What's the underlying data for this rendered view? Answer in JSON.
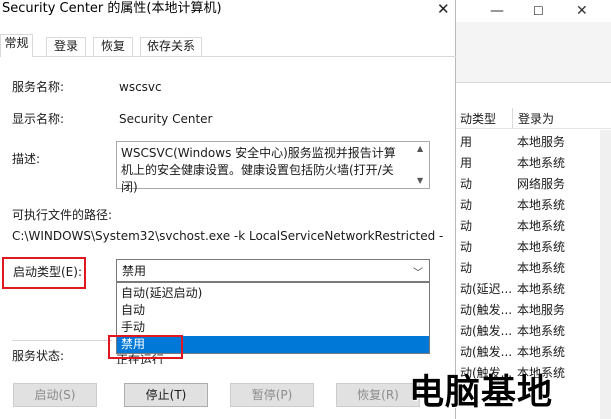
{
  "window": {
    "title": "Security Center 的属性(本地计算机)",
    "close_glyph": "✕"
  },
  "tabs": [
    {
      "label": "常规",
      "active": true
    },
    {
      "label": "登录",
      "active": false
    },
    {
      "label": "恢复",
      "active": false
    },
    {
      "label": "依存关系",
      "active": false
    }
  ],
  "fields": {
    "service_name_label": "服务名称:",
    "service_name_value": "wscsvc",
    "display_name_label": "显示名称:",
    "display_name_value": "Security Center",
    "description_label": "描述:",
    "description_value": "WSCSVC(Windows 安全中心)服务监视并报告计算机上的安全健康设置。健康设置包括防火墙(打开/关闭)",
    "path_label": "可执行文件的路径:",
    "path_value": "C:\\WINDOWS\\System32\\svchost.exe -k LocalServiceNetworkRestricted -",
    "startup_type_label": "启动类型(E):",
    "startup_type_value": "禁用",
    "service_status_label": "服务状态:",
    "service_status_value": "正在运行"
  },
  "startup_options": [
    "自动(延迟启动)",
    "自动",
    "手动",
    "禁用"
  ],
  "startup_selected_index": 3,
  "buttons": {
    "start": "启动(S)",
    "stop": "停止(T)",
    "pause": "暂停(P)",
    "resume": "恢复(R)"
  },
  "services_list": {
    "headers": [
      "启动类型",
      "登录为"
    ],
    "header_visible": [
      "动类型",
      "登录为"
    ],
    "rows": [
      [
        "用",
        "本地服务"
      ],
      [
        "用",
        "本地系统"
      ],
      [
        "动",
        "网络服务"
      ],
      [
        "动",
        "本地系统"
      ],
      [
        "动",
        "本地系统"
      ],
      [
        "动",
        "本地系统"
      ],
      [
        "动",
        "本地系统"
      ],
      [
        "动(延迟...",
        "本地系统"
      ],
      [
        "动(触发...",
        "本地服务"
      ],
      [
        "动(触发...",
        "本地系统"
      ],
      [
        "动(触发...",
        "本地系统"
      ],
      [
        "动(触发...",
        "本地系统"
      ]
    ]
  },
  "watermark": "电脑基地",
  "colors": {
    "highlight": "#0078d7",
    "annotation_red": "#e0181f"
  }
}
